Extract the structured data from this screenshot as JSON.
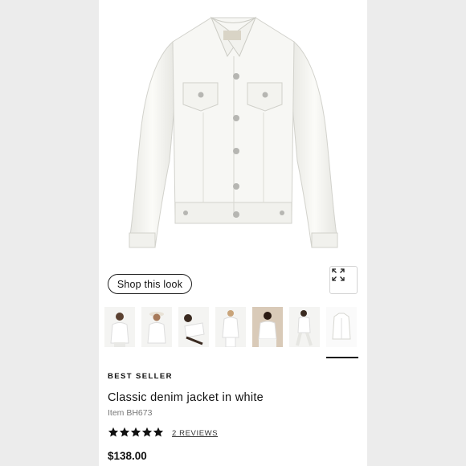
{
  "shop_look": {
    "label": "Shop this look"
  },
  "expand": {
    "icon": "expand-arrows-icon"
  },
  "thumbnails": [
    {
      "name": "thumbnail-model-front"
    },
    {
      "name": "thumbnail-model-hat"
    },
    {
      "name": "thumbnail-model-reclining"
    },
    {
      "name": "thumbnail-model-full"
    },
    {
      "name": "thumbnail-model-seated"
    },
    {
      "name": "thumbnail-model-walking"
    },
    {
      "name": "thumbnail-flat-lay"
    }
  ],
  "product": {
    "badge": "BEST SELLER",
    "title": "Classic denim jacket in white",
    "item_number": "Item BH673",
    "rating": 5,
    "reviews": "2 REVIEWS",
    "price": "$138.00"
  },
  "colors": {
    "text": "#111111",
    "muted": "#777777",
    "outer_bg": "#ececec"
  }
}
